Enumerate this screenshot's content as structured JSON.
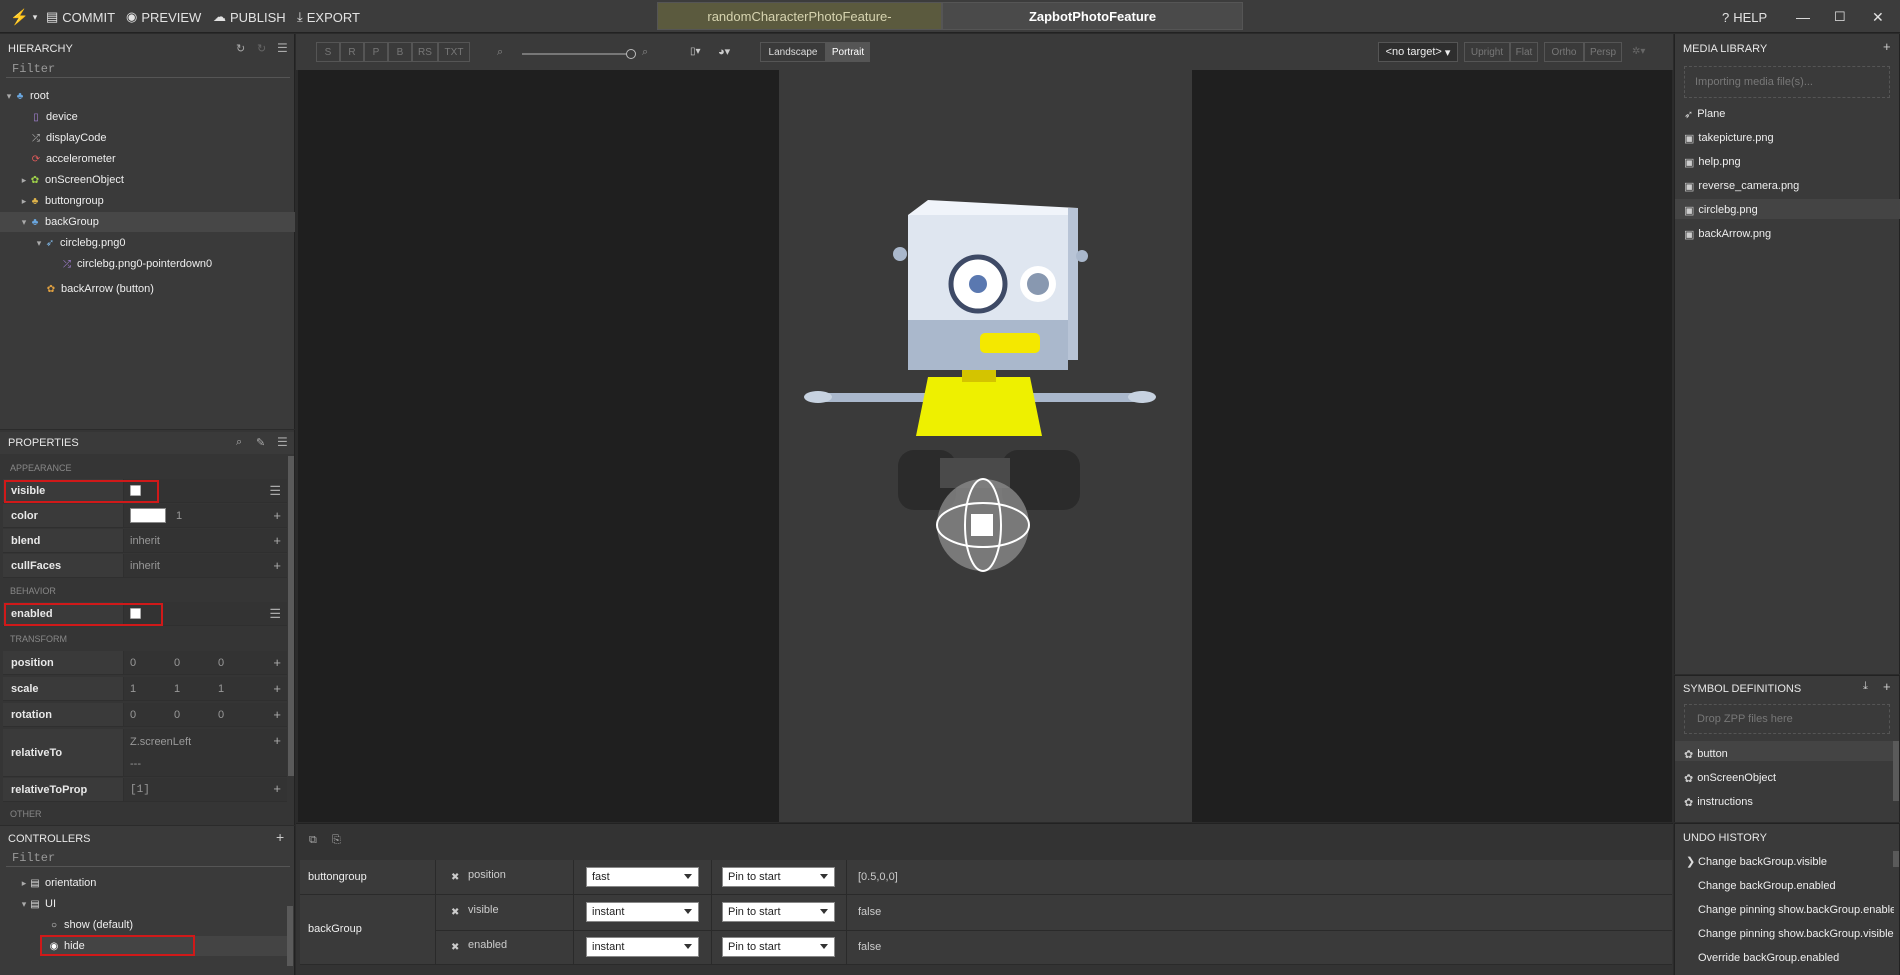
{
  "toolbar": {
    "commit": "COMMIT",
    "preview": "PREVIEW",
    "publish": "PUBLISH",
    "export": "EXPORT",
    "help": "HELP"
  },
  "tabs": [
    {
      "label": "randomCharacterPhotoFeature-",
      "active": false
    },
    {
      "label": "ZapbotPhotoFeature",
      "active": true
    }
  ],
  "hierarchy": {
    "title": "HIERARCHY",
    "filter_placeholder": "Filter",
    "items": [
      {
        "label": "root",
        "icon": "group-icon"
      },
      {
        "label": "device",
        "icon": "device-icon"
      },
      {
        "label": "displayCode",
        "icon": "shuffle-icon"
      },
      {
        "label": "accelerometer",
        "icon": "sync-icon"
      },
      {
        "label": "onScreenObject",
        "icon": "gear-icon"
      },
      {
        "label": "buttongroup",
        "icon": "group-icon"
      },
      {
        "label": "backGroup",
        "icon": "group-icon"
      },
      {
        "label": "circlebg.png0",
        "icon": "rocket-icon"
      },
      {
        "label": "circlebg.png0-pointerdown0",
        "icon": "shuffle-icon"
      },
      {
        "label": "backArrow (button)",
        "icon": "gear-icon"
      }
    ]
  },
  "properties": {
    "title": "PROPERTIES",
    "sections": {
      "appearance": "APPEARANCE",
      "behavior": "BEHAVIOR",
      "transform": "TRANSFORM",
      "other": "OTHER"
    },
    "visible": "visible",
    "color": "color",
    "color_alpha": "1",
    "blend": "blend",
    "blend_value": "inherit",
    "cullFaces": "cullFaces",
    "cullFaces_value": "inherit",
    "enabled": "enabled",
    "position": "position",
    "position_values": [
      "0",
      "0",
      "0"
    ],
    "scale": "scale",
    "scale_values": [
      "1",
      "1",
      "1"
    ],
    "rotation": "rotation",
    "rotation_values": [
      "0",
      "0",
      "0"
    ],
    "relativeTo": "relativeTo",
    "relativeTo_value": "Z.screenLeft",
    "relativeTo_value2": "---",
    "relativeToProp": "relativeToProp",
    "relativeToProp_value": "[1]"
  },
  "controllers": {
    "title": "CONTROLLERS",
    "filter_placeholder": "Filter",
    "items": [
      {
        "label": "orientation"
      },
      {
        "label": "UI"
      },
      {
        "label": "show (default)"
      },
      {
        "label": "hide"
      }
    ]
  },
  "viewport": {
    "tools": [
      "S",
      "R",
      "P",
      "B",
      "RS",
      "TXT"
    ],
    "landscape": "Landscape",
    "portrait": "Portrait",
    "target": "<no target>",
    "views": [
      "Upright",
      "Flat",
      "Ortho",
      "Persp"
    ]
  },
  "media_library": {
    "title": "MEDIA LIBRARY",
    "drop_text": "Importing media file(s)...",
    "items": [
      "Plane",
      "takepicture.png",
      "help.png",
      "reverse_camera.png",
      "circlebg.png",
      "backArrow.png"
    ]
  },
  "symbols": {
    "title": "SYMBOL DEFINITIONS",
    "drop_text": "Drop ZPP files here",
    "items": [
      "button",
      "onScreenObject",
      "instructions"
    ]
  },
  "timeline": {
    "rows": [
      {
        "group": "buttongroup",
        "prop": "position",
        "ease": "fast",
        "pin": "Pin to start",
        "value": "[0.5,0,0]"
      },
      {
        "group": "backGroup",
        "prop": "visible",
        "ease": "instant",
        "pin": "Pin to start",
        "value": "false"
      },
      {
        "group": "",
        "prop": "enabled",
        "ease": "instant",
        "pin": "Pin to start",
        "value": "false"
      }
    ]
  },
  "undo_history": {
    "title": "UNDO HISTORY",
    "items": [
      "Change backGroup.visible",
      "Change backGroup.enabled",
      "Change pinning show.backGroup.enabled",
      "Change pinning show.backGroup.visible",
      "Override backGroup.enabled"
    ]
  }
}
